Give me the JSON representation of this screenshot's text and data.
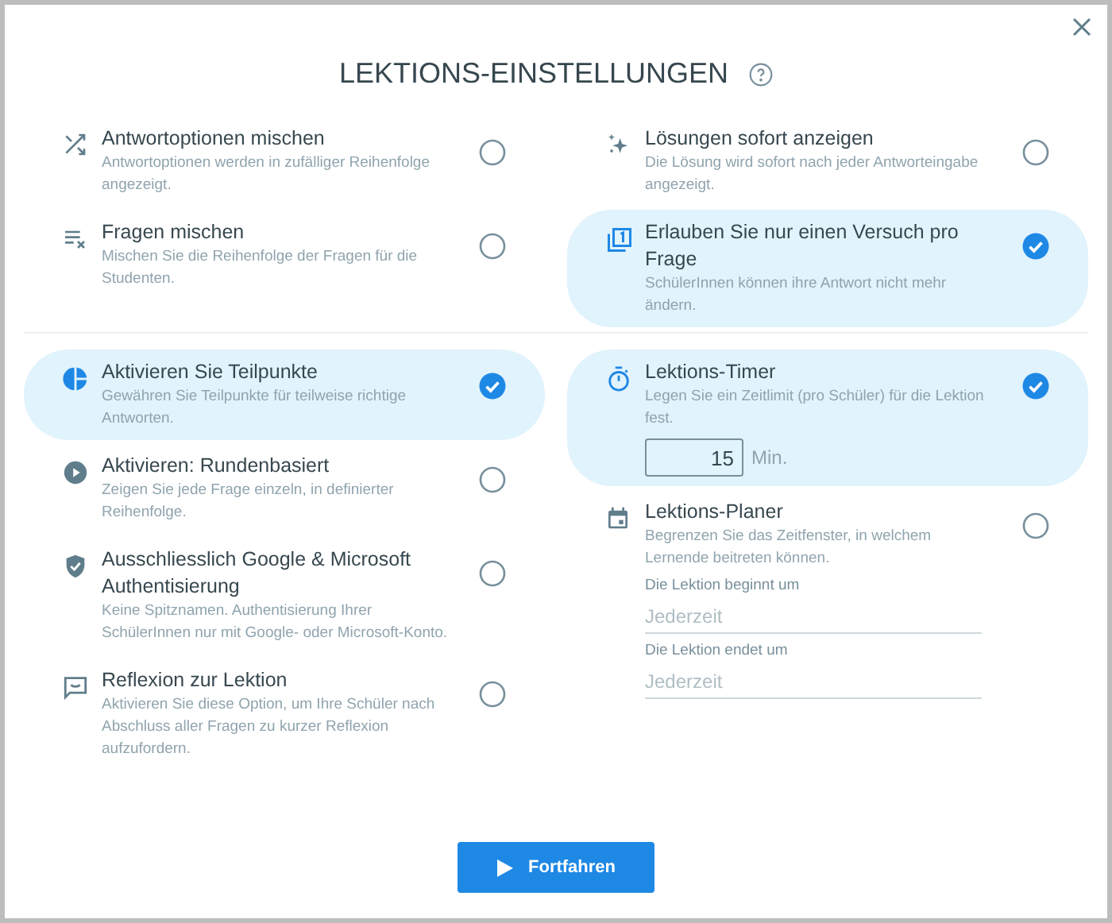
{
  "dialog": {
    "title": "LEKTIONS-EINSTELLUNGEN"
  },
  "sections": [
    {
      "left": [
        {
          "kind": "toggle",
          "title": "Antwortoptionen mischen",
          "description": "Antwortoptionen werden in zufälliger Reihenfolge angezeigt.",
          "checked": false
        },
        {
          "kind": "toggle",
          "title": "Fragen mischen",
          "description": "Mischen Sie die Reihenfolge der Fragen für die Studenten.",
          "checked": false
        }
      ],
      "right": [
        {
          "kind": "toggle",
          "title": "Lösungen sofort anzeigen",
          "description": "Die Lösung wird sofort nach jeder Antworteingabe angezeigt.",
          "checked": false
        },
        {
          "kind": "toggle",
          "title": "Erlauben Sie nur einen Versuch pro Frage",
          "description": "SchülerInnen können ihre Antwort nicht mehr ändern.",
          "checked": true
        }
      ]
    },
    {
      "left": [
        {
          "kind": "toggle",
          "title": "Aktivieren Sie Teilpunkte",
          "description": "Gewähren Sie Teilpunkte für teilweise richtige Antworten.",
          "checked": true
        },
        {
          "kind": "toggle",
          "title": "Aktivieren: Rundenbasiert",
          "description": "Zeigen Sie jede Frage einzeln, in definierter Reihenfolge.",
          "checked": false
        },
        {
          "kind": "toggle",
          "title": "Ausschliesslich Google & Microsoft Authentisierung",
          "description": "Keine Spitznamen. Authentisierung Ihrer SchülerInnen nur mit Google- oder Microsoft-Konto.",
          "checked": false
        },
        {
          "kind": "toggle",
          "title": "Reflexion zur Lektion",
          "description": "Aktivieren Sie diese Option, um Ihre Schüler nach Abschluss aller Fragen zu kurzer Reflexion aufzufordern.",
          "checked": false
        }
      ],
      "right": [
        {
          "kind": "timer",
          "title": "Lektions-Timer",
          "description": "Legen Sie ein Zeitlimit (pro Schüler) für die Lektion fest.",
          "checked": true,
          "minutes": "15",
          "unit": "Min."
        },
        {
          "kind": "schedule",
          "title": "Lektions-Planer",
          "description": "Begrenzen Sie das Zeitfenster, in welchem Lernende beitreten können.",
          "checked": false,
          "fields": [
            {
              "label": "Die Lektion beginnt um",
              "placeholder": "Jederzeit"
            },
            {
              "label": "Die Lektion endet um",
              "placeholder": "Jederzeit"
            }
          ]
        }
      ]
    }
  ],
  "button": {
    "label": "Fortfahren"
  }
}
